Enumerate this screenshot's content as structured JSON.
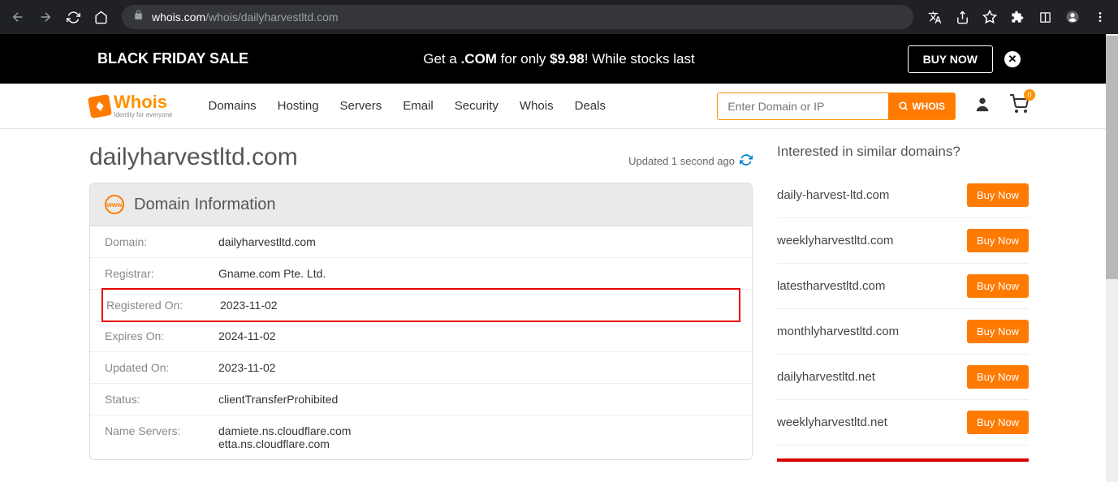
{
  "browser": {
    "url_prefix": "whois.com",
    "url_path": "/whois/dailyharvestltd.com"
  },
  "promo": {
    "left": "BLACK FRIDAY SALE",
    "center_1": "Get a ",
    "center_bold1": ".COM",
    "center_2": " for only ",
    "center_bold2": "$9.98",
    "center_3": "! While stocks last",
    "button": "BUY NOW"
  },
  "header": {
    "logo_text": "Whois",
    "logo_sub": "Identity for everyone",
    "nav": [
      "Domains",
      "Hosting",
      "Servers",
      "Email",
      "Security",
      "Whois",
      "Deals"
    ],
    "search_placeholder": "Enter Domain or IP",
    "search_button": "WHOIS",
    "cart_count": "0"
  },
  "page": {
    "domain_title": "dailyharvestltd.com",
    "updated_text": "Updated 1 second ago",
    "card_title": "Domain Information",
    "rows": [
      {
        "label": "Domain:",
        "value": "dailyharvestltd.com",
        "highlight": false
      },
      {
        "label": "Registrar:",
        "value": "Gname.com Pte. Ltd.",
        "highlight": false
      },
      {
        "label": "Registered On:",
        "value": "2023-11-02",
        "highlight": true
      },
      {
        "label": "Expires On:",
        "value": "2024-11-02",
        "highlight": false
      },
      {
        "label": "Updated On:",
        "value": "2023-11-02",
        "highlight": false
      },
      {
        "label": "Status:",
        "value": "clientTransferProhibited",
        "highlight": false
      },
      {
        "label": "Name Servers:",
        "value": "damiete.ns.cloudflare.com\netta.ns.cloudflare.com",
        "highlight": false
      }
    ]
  },
  "sidebar": {
    "title": "Interested in similar domains?",
    "buy_label": "Buy Now",
    "items": [
      "daily-harvest-ltd.com",
      "weeklyharvestltd.com",
      "latestharvestltd.com",
      "monthlyharvestltd.com",
      "dailyharvestltd.net",
      "weeklyharvestltd.net"
    ]
  }
}
